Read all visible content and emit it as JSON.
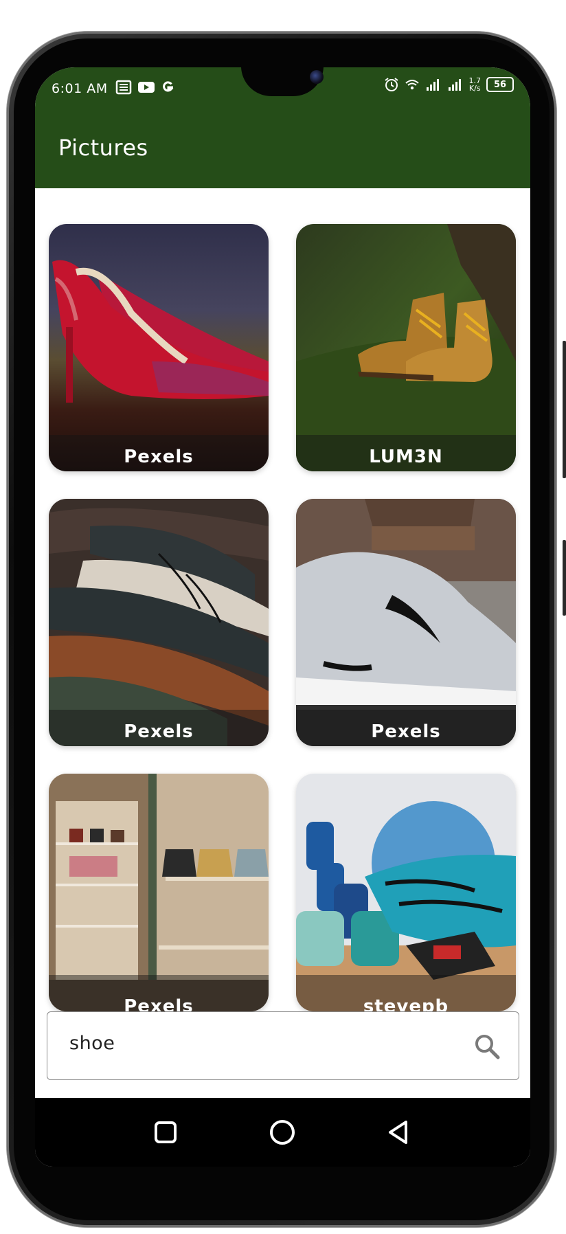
{
  "status_bar": {
    "time": "6:01 AM",
    "left_icons": [
      "news-icon",
      "youtube-icon",
      "google-icon"
    ],
    "right_icons": [
      "alarm-icon",
      "wifi-icon",
      "signal-icon",
      "signal-icon"
    ],
    "net_speed_value": "1.7",
    "net_speed_unit": "K/s",
    "battery": "56"
  },
  "app_bar": {
    "title": "Pictures",
    "color": "#254d18"
  },
  "gallery": {
    "items": [
      {
        "caption": "Pexels"
      },
      {
        "caption": "LUM3N"
      },
      {
        "caption": "Pexels"
      },
      {
        "caption": "Pexels"
      },
      {
        "caption": "Pexels"
      },
      {
        "caption": "stevepb"
      }
    ]
  },
  "search": {
    "value": "shoe",
    "icon": "search-icon"
  },
  "nav_bar": {
    "buttons": [
      "recent-apps-icon",
      "home-icon",
      "back-icon"
    ]
  }
}
